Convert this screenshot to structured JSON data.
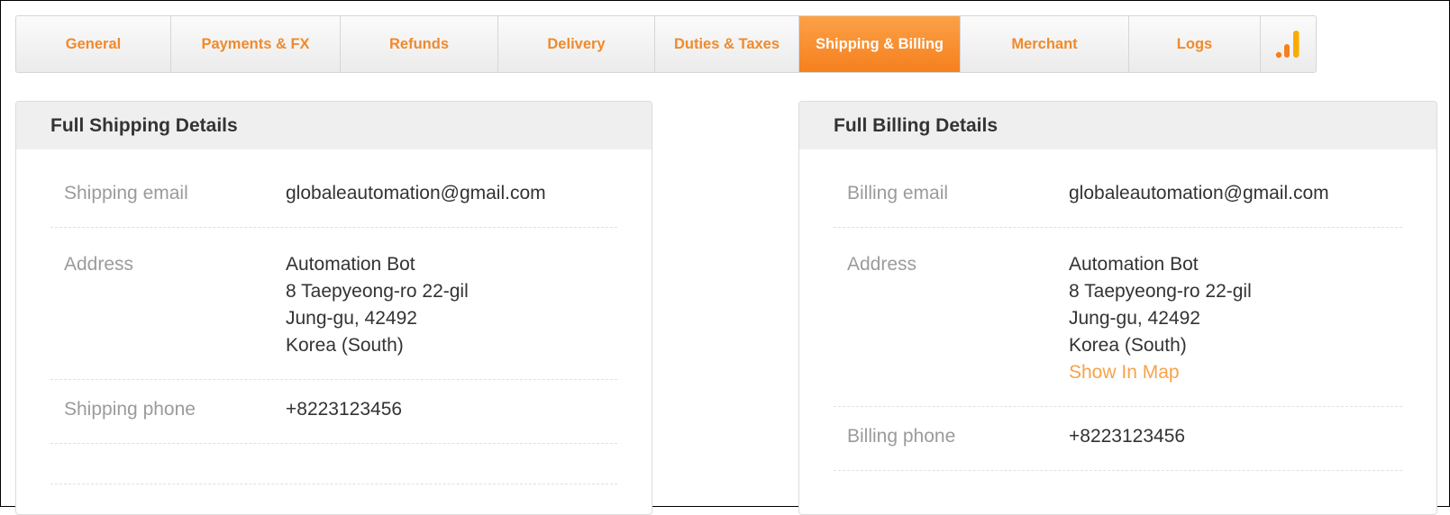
{
  "tabs": [
    {
      "label": "General"
    },
    {
      "label": "Payments & FX"
    },
    {
      "label": "Refunds"
    },
    {
      "label": "Delivery"
    },
    {
      "label": "Duties & Taxes"
    },
    {
      "label": "Shipping & Billing"
    },
    {
      "label": "Merchant"
    },
    {
      "label": "Logs"
    }
  ],
  "active_tab": "Shipping & Billing",
  "tab_icon": "analytics-bar-chart-icon",
  "colors": {
    "accent": "#f5801e",
    "tab_text": "#f08a2c",
    "link": "#f7a24a"
  },
  "shipping": {
    "title": "Full Shipping Details",
    "email_label": "Shipping email",
    "email": "globaleautomation@gmail.com",
    "address_label": "Address",
    "address_lines": [
      "Automation Bot",
      "8 Taepyeong-ro 22-gil",
      "Jung-gu, 42492",
      "Korea (South)"
    ],
    "phone_label": "Shipping phone",
    "phone": "+8223123456"
  },
  "billing": {
    "title": "Full Billing Details",
    "email_label": "Billing email",
    "email": "globaleautomation@gmail.com",
    "address_label": "Address",
    "address_lines": [
      "Automation Bot",
      "8 Taepyeong-ro 22-gil",
      "Jung-gu, 42492",
      "Korea (South)"
    ],
    "map_link": "Show In Map",
    "phone_label": "Billing phone",
    "phone": "+8223123456"
  }
}
